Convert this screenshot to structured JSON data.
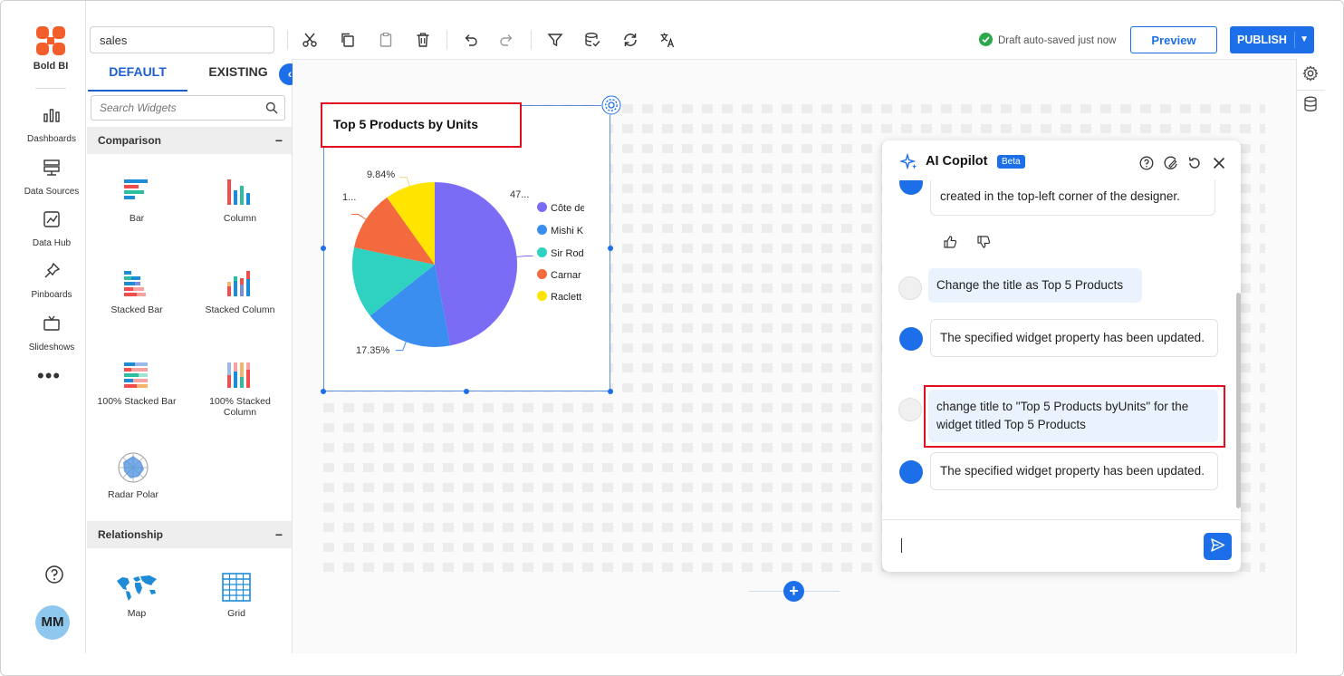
{
  "app": {
    "logo_text": "Bold BI",
    "user_initials": "MM"
  },
  "nav": {
    "items": [
      {
        "label": "Dashboards",
        "icon": "bar-chart-icon"
      },
      {
        "label": "Data Sources",
        "icon": "server-icon"
      },
      {
        "label": "Data Hub",
        "icon": "image-chart-icon"
      },
      {
        "label": "Pinboards",
        "icon": "pin-icon"
      },
      {
        "label": "Slideshows",
        "icon": "tv-icon"
      }
    ],
    "more": "•••"
  },
  "toolbar": {
    "dashboard_name": "sales",
    "saved_status": "Draft auto-saved just now",
    "preview_label": "Preview",
    "publish_label": "PUBLISH"
  },
  "panel": {
    "tabs": [
      "DEFAULT",
      "EXISTING"
    ],
    "search_placeholder": "Search Widgets",
    "sections": [
      {
        "name": "Comparison",
        "widgets": [
          "Bar",
          "Column",
          "Stacked Bar",
          "Stacked Column",
          "100% Stacked Bar",
          "100% Stacked Column",
          "Radar Polar"
        ]
      },
      {
        "name": "Relationship",
        "widgets": [
          "Map",
          "Grid"
        ]
      }
    ],
    "collapse_symbol": "−"
  },
  "widget": {
    "title": "Top 5 Products by Units"
  },
  "chart_data": {
    "type": "pie",
    "title": "Top 5 Products by Units",
    "slices": [
      {
        "label": "Côte de",
        "value": 47.0,
        "display": "47...",
        "color": "#7b6cf6"
      },
      {
        "label": "Mishi K",
        "value": 17.35,
        "display": "17.35%",
        "color": "#3a8ef0"
      },
      {
        "label": "Sir Rod",
        "value": 14.0,
        "display": "",
        "color": "#2fd2c0"
      },
      {
        "label": "Carnar",
        "value": 11.81,
        "display": "1...",
        "color": "#f46a3f"
      },
      {
        "label": "Raclett",
        "value": 9.84,
        "display": "9.84%",
        "color": "#ffe500"
      }
    ],
    "legend_position": "right"
  },
  "copilot": {
    "title": "AI Copilot",
    "badge": "Beta",
    "messages": [
      {
        "from": "bot",
        "text": "created in the top-left corner of the designer."
      },
      {
        "from": "user",
        "text": "Change the title as Top 5 Products"
      },
      {
        "from": "bot",
        "text": "The specified widget property has been updated."
      },
      {
        "from": "user",
        "text": "change title to \"Top 5 Products byUnits\" for the widget titled Top 5 Products"
      },
      {
        "from": "bot",
        "text": "The specified widget property has been updated."
      }
    ],
    "input_value": ""
  }
}
